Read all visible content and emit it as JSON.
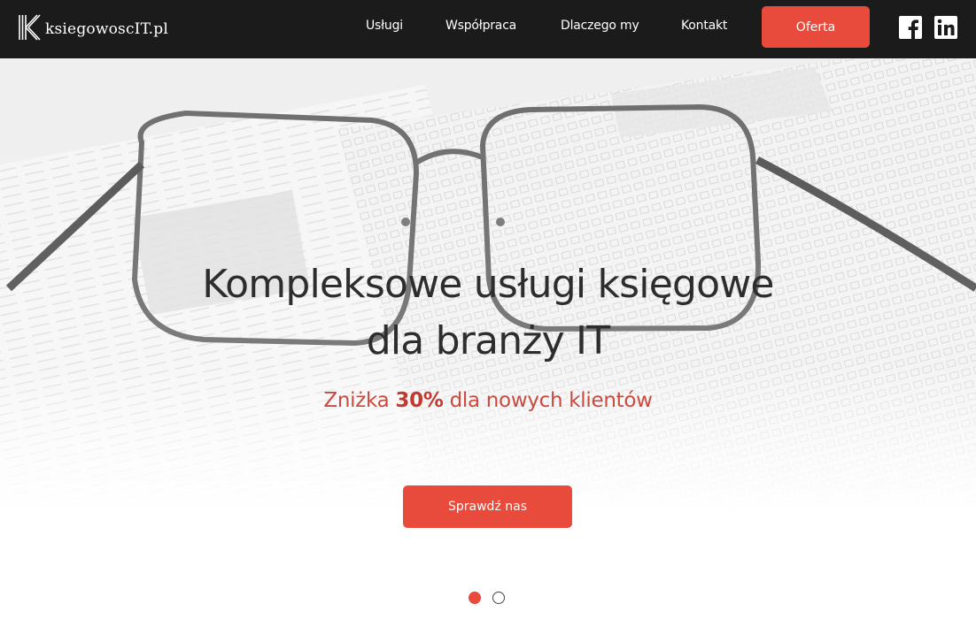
{
  "brand": {
    "name": "ksiegowoscIT.pl",
    "logo_icon": "k-monogram-icon"
  },
  "nav": {
    "links": [
      "Usługi",
      "Współpraca",
      "Dlaczego my",
      "Kontakt"
    ],
    "cta": "Oferta"
  },
  "social": {
    "facebook_icon": "facebook-icon",
    "linkedin_icon": "linkedin-icon"
  },
  "hero": {
    "title_line1": "Kompleksowe usługi księgowe",
    "title_line2": "dla branży IT",
    "subtitle_prefix": "Zniżka ",
    "subtitle_highlight": "30%",
    "subtitle_suffix": " dla nowych klientów",
    "button": "Sprawdź nas",
    "slides_total": 2,
    "active_slide": 1
  },
  "colors": {
    "accent": "#e84a3b",
    "navbar": "#1b1b1b",
    "subtitle": "#c94a3f"
  }
}
